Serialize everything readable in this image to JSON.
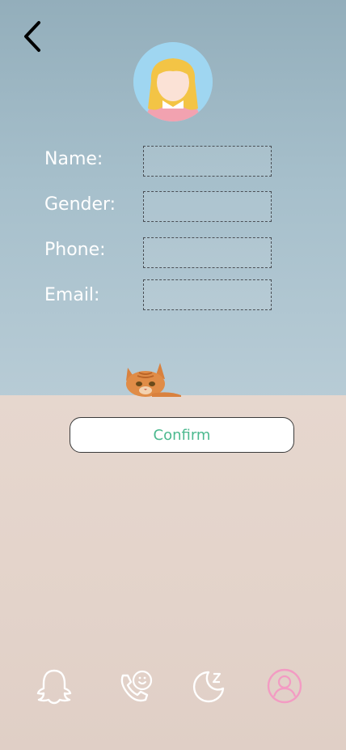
{
  "form": {
    "name_label": "Name:",
    "gender_label": "Gender:",
    "phone_label": "Phone:",
    "email_label": "Email:",
    "name_value": "",
    "gender_value": "",
    "phone_value": "",
    "email_value": ""
  },
  "confirm_label": "Confirm",
  "nav": {
    "items": [
      {
        "icon": "ghost-icon"
      },
      {
        "icon": "phone-icon"
      },
      {
        "icon": "moon-sleep-icon"
      },
      {
        "icon": "profile-icon",
        "active": true
      }
    ]
  },
  "colors": {
    "accent": "#4cb98f",
    "active_nav": "#f39bc3",
    "sky": "#a6bfcb",
    "wall": "#e3d3ca"
  }
}
